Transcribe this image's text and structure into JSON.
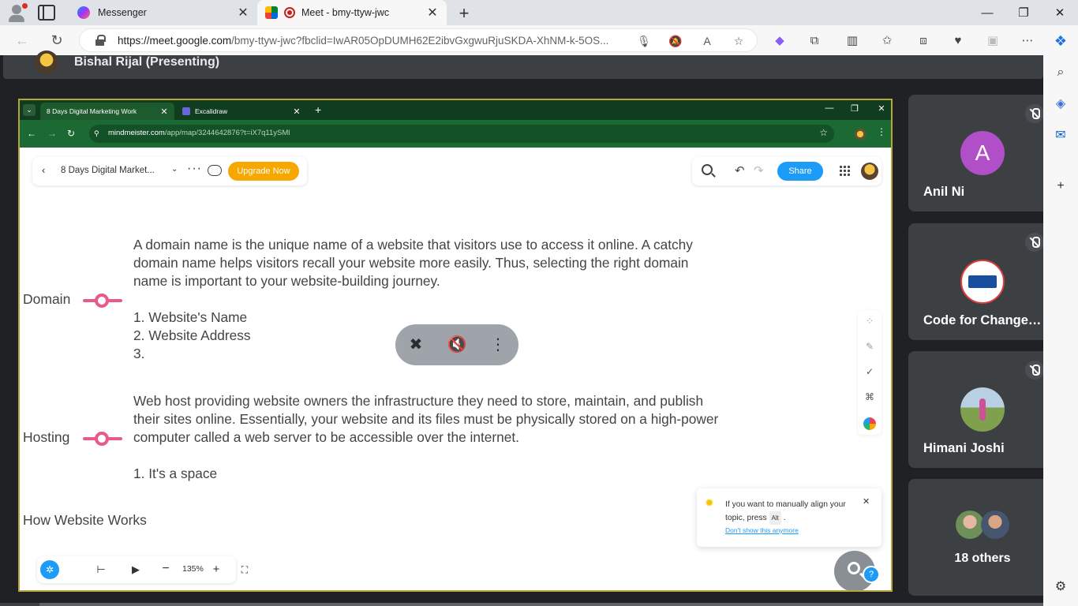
{
  "browser": {
    "tabs": [
      {
        "label": "Messenger",
        "active": false
      },
      {
        "label": "Meet - bmy-ttyw-jwc",
        "active": true
      }
    ],
    "url_host": "https://meet.google.com",
    "url_path": "/bmy-ttyw-jwc?fbclid=IwAR05OpDUMH62E2ibvGxgwuRjuSKDA-XhNM-k-5OS..."
  },
  "meet": {
    "presenter_name": "Bishal Rijal (Presenting)",
    "participants": [
      {
        "name": "Anil Ni",
        "initial": "A",
        "color": "#b04fc7"
      },
      {
        "name": "Code for Change ...",
        "initial": "",
        "color": "#ffffff"
      },
      {
        "name": "Himani Joshi",
        "initial": "",
        "color": "#7fa14e"
      }
    ],
    "others_label": "18 others"
  },
  "shared_screen": {
    "tabs": [
      {
        "label": "8 Days Digital Marketing Work"
      },
      {
        "label": "Excalidraw"
      }
    ],
    "url_host": "mindmeister.com",
    "url_path": "/app/map/3244642876?t=iX7q11ySMl",
    "mindmeister": {
      "map_title": "8 Days Digital Market...",
      "upgrade_label": "Upgrade Now",
      "share_label": "Share",
      "zoom_level": "135%",
      "nodes": [
        {
          "label": "Domain",
          "note": [
            "A domain name is the unique name of a website that visitors use to access it online. A catchy",
            "domain name helps visitors recall your website more easily. Thus, selecting the right domain",
            "name is important to your website-building journey."
          ],
          "list": [
            "1. Website's Name",
            "2. Website Address",
            "3."
          ]
        },
        {
          "label": "Hosting",
          "note": [
            "Web host providing website owners the infrastructure they need to store, maintain, and publish",
            "their sites online. Essentially, your website and its files must be physically stored on a high-power",
            "computer called a web server to be accessible over the internet."
          ],
          "list": [
            "1. It's a space"
          ]
        },
        {
          "label": "How Website Works"
        }
      ],
      "tip": {
        "message": "If you want to manually align your topic, press",
        "key": "Alt",
        "suffix": ".",
        "link": "Don't show this anymore"
      }
    }
  },
  "colors": {
    "accent_pink": "#e85a8c",
    "share_blue": "#1c9cf6",
    "upgrade_orange": "#f7a800"
  }
}
